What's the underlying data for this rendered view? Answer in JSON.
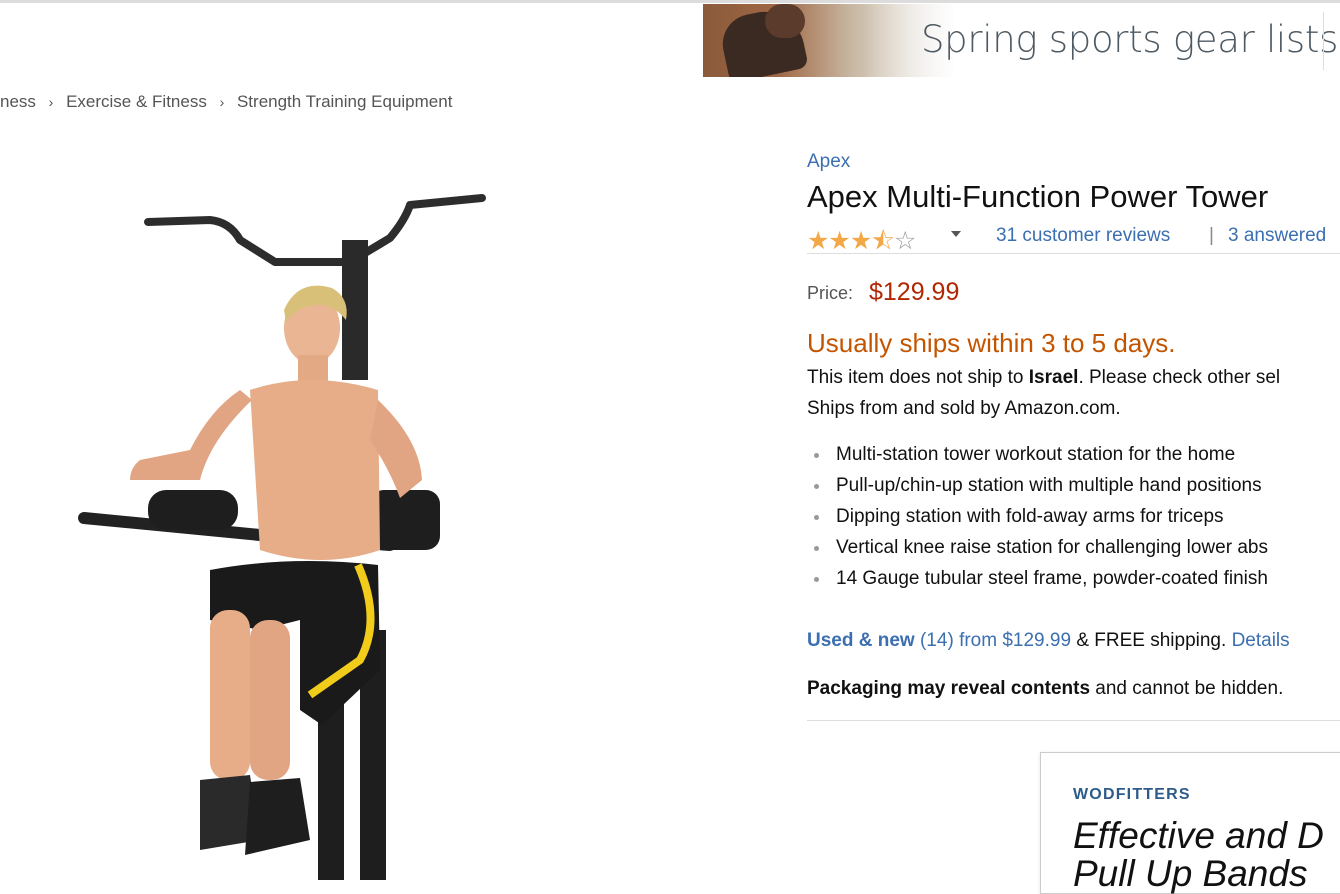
{
  "banner": {
    "text": "Spring sports gear lists"
  },
  "breadcrumb": {
    "items": [
      "ness",
      "Exercise & Fitness",
      "Strength Training Equipment"
    ],
    "separator": "›"
  },
  "product": {
    "brand": "Apex",
    "title": "Apex Multi-Function Power Tower",
    "rating": 3.5,
    "rating_max": 5,
    "reviews_link": "31 customer reviews",
    "separator": "|",
    "answered_link": "3 answered",
    "price_label": "Price:",
    "price_value": "$129.99",
    "availability": "Usually ships within 3 to 5 days.",
    "noship_prefix": "This item does not ship to ",
    "noship_country": "Israel",
    "noship_suffix": ". Please check other sel",
    "sold_by": "Ships from and sold by Amazon.com.",
    "features": [
      "Multi-station tower workout station for the home",
      "Pull-up/chin-up station with multiple hand positions",
      "Dipping station with fold-away arms for triceps",
      "Vertical knee raise station for challenging lower abs",
      "14 Gauge tubular steel frame, powder-coated finish"
    ],
    "used_new_label": "Used & new",
    "used_new_count": "(14)",
    "used_new_from": "from $129.99",
    "free_shipping": "& FREE shipping.",
    "details_link": "Details",
    "packaging_bold": "Packaging may reveal contents",
    "packaging_rest": "and cannot be hidden."
  },
  "ad": {
    "brand": "WODFITTERS",
    "headline_line1": "Effective and D",
    "headline_line2": "Pull Up Bands"
  },
  "colors": {
    "link": "#3b6fb0",
    "price": "#b12704",
    "availability": "#c45500",
    "star": "#f3a847"
  }
}
